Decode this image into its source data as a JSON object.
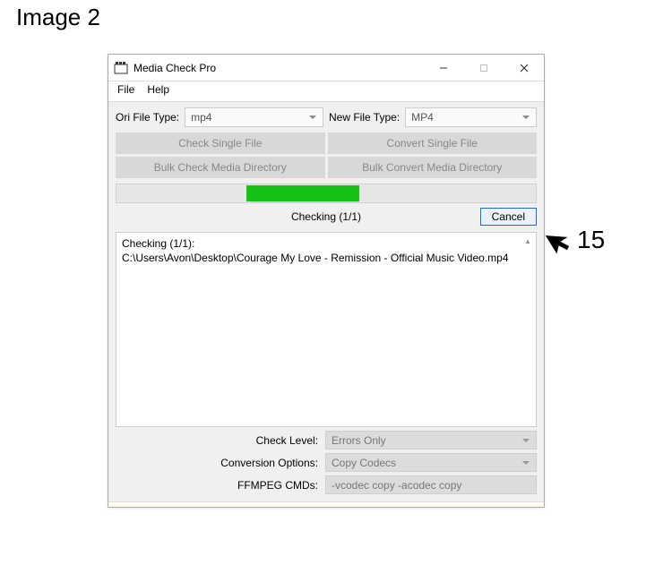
{
  "image_label": "Image 2",
  "window": {
    "title": "Media Check Pro",
    "menus": {
      "file": "File",
      "help": "Help"
    },
    "ori_label": "Ori File Type:",
    "ori_value": "mp4",
    "new_label": "New File Type:",
    "new_value": "MP4",
    "buttons": {
      "check_single": "Check Single File",
      "convert_single": "Convert Single File",
      "check_dir": "Bulk Check Media Directory",
      "convert_dir": "Bulk Convert Media Directory"
    },
    "progress": {
      "left_pct": 31,
      "width_pct": 27
    },
    "status": "Checking (1/1)",
    "cancel": "Cancel",
    "log": "Checking (1/1):\nC:\\Users\\Avon\\Desktop\\Courage My Love - Remission - Official Music Video.mp4",
    "check_level_label": "Check Level:",
    "check_level_value": "Errors Only",
    "conv_opts_label": "Conversion Options:",
    "conv_opts_value": "Copy Codecs",
    "ffmpeg_label": "FFMPEG CMDs:",
    "ffmpeg_value": "-vcodec copy -acodec copy"
  },
  "annotation": "15"
}
